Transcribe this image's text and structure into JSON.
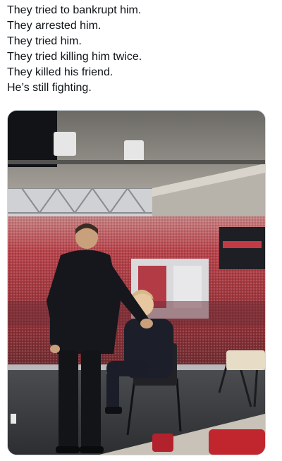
{
  "post": {
    "lines": [
      "They tried to bankrupt him.",
      "They arrested him.",
      "They tried him.",
      "They tried killing him twice.",
      "They killed his friend.",
      "He’s still fighting."
    ]
  },
  "media": {
    "description_icon": "photo",
    "colors": {
      "stadium_crowd": "#b8424a",
      "ceiling": "#8d8a84",
      "suit_dark": "#1b1d24",
      "chair": "#2a2a2e",
      "floor": "#3a3c3f"
    }
  }
}
